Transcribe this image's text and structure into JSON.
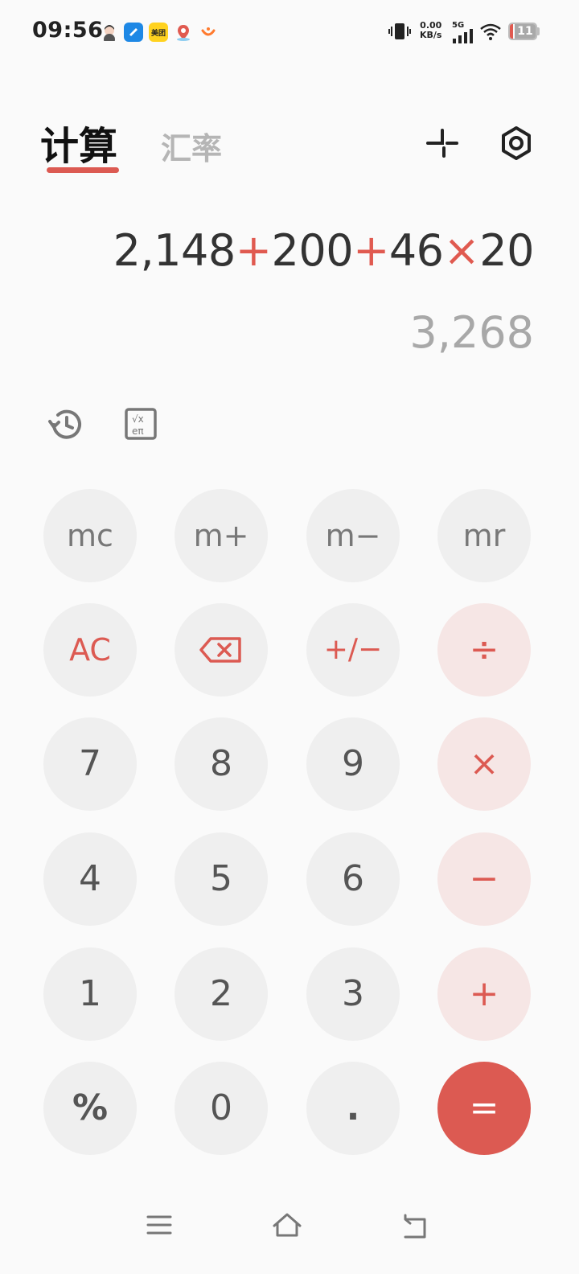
{
  "status_bar": {
    "time": "09:56",
    "net_speed_value": "0.00",
    "net_speed_unit": "KB/s",
    "network_type": "5G",
    "battery_level": "11",
    "battery_fraction": 0.11,
    "app_icons": [
      "avatar-app-icon",
      "blue-app-icon",
      "meituan-icon",
      "map-icon",
      "didi-icon"
    ],
    "meituan_label": "美团"
  },
  "header": {
    "tab_active": "计算",
    "tab_inactive": "汇率"
  },
  "display": {
    "expression_parts": [
      {
        "text": "2,148",
        "type": "num"
      },
      {
        "text": "+",
        "type": "op"
      },
      {
        "text": "200",
        "type": "num"
      },
      {
        "text": "+",
        "type": "op"
      },
      {
        "text": "46",
        "type": "num"
      },
      {
        "text": "×",
        "type": "op"
      },
      {
        "text": "20",
        "type": "num"
      }
    ],
    "result": "3,268"
  },
  "tools": {
    "history_icon": "history-icon",
    "scientific_icon": "scientific-functions-icon"
  },
  "keypad": {
    "mc": "mc",
    "mplus": "m+",
    "mminus": "m−",
    "mr": "mr",
    "ac": "AC",
    "backspace": "backspace-icon",
    "plusminus": "+/−",
    "divide": "÷",
    "seven": "7",
    "eight": "8",
    "nine": "9",
    "multiply": "×",
    "four": "4",
    "five": "5",
    "six": "6",
    "minus": "−",
    "one": "1",
    "two": "2",
    "three": "3",
    "plus": "+",
    "percent": "%",
    "zero": "0",
    "dot": ".",
    "equals": "="
  },
  "colors": {
    "accent": "#dc5a52",
    "key_bg": "#efefef",
    "op_key_bg": "#f6e6e5"
  }
}
